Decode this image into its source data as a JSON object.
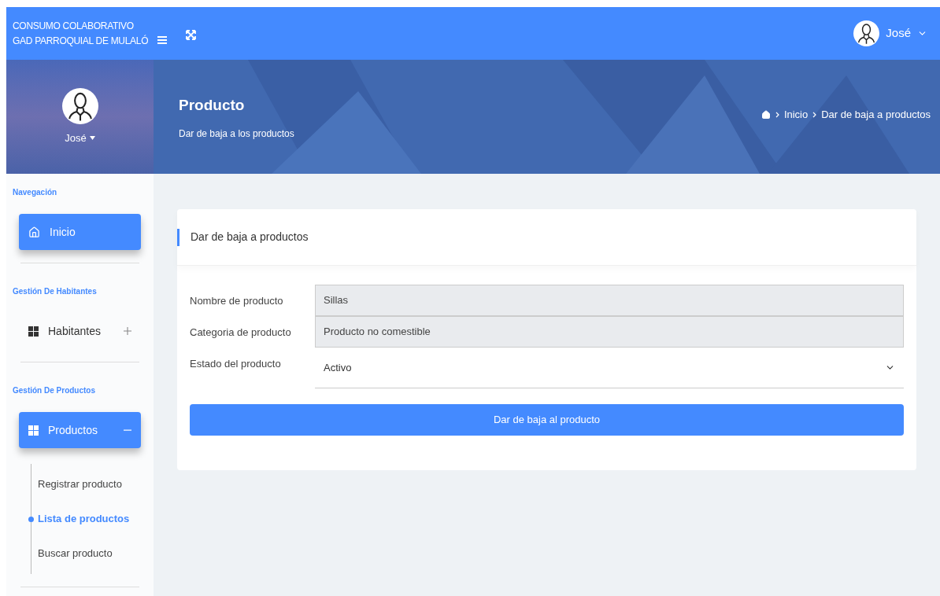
{
  "topbar": {
    "brand_lines": [
      "CONSUMO COLABORATIVO",
      "GAD PARROQUIAL DE MULALÓ"
    ],
    "user_name": "José"
  },
  "profile": {
    "name": "José"
  },
  "page_header": {
    "title": "Producto",
    "subtitle": "Dar de baja a los productos",
    "breadcrumb": [
      "Inicio",
      "Dar de baja a productos"
    ]
  },
  "sidebar": {
    "sections": [
      {
        "heading": "Navegación",
        "items": [
          {
            "label": "Inicio",
            "kind": "link",
            "selected": true
          }
        ]
      },
      {
        "heading": "Gestión De Habitantes",
        "items": [
          {
            "label": "Habitantes",
            "kind": "group",
            "selected": false,
            "expanded": false
          }
        ]
      },
      {
        "heading": "Gestión De Productos",
        "items": [
          {
            "label": "Productos",
            "kind": "group",
            "selected": true,
            "expanded": true,
            "children": [
              {
                "label": "Registrar producto",
                "selected": false
              },
              {
                "label": "Lista de productos",
                "selected": true
              },
              {
                "label": "Buscar producto",
                "selected": false
              }
            ]
          }
        ]
      }
    ]
  },
  "card": {
    "title": "Dar de baja a productos",
    "fields": [
      {
        "label": "Nombre de producto",
        "value": "Sillas",
        "kind": "readonly"
      },
      {
        "label": "Categoria de producto",
        "value": "Producto no comestible",
        "kind": "readonly"
      },
      {
        "label": "Estado del producto",
        "value": "Activo",
        "kind": "select"
      }
    ],
    "button": "Dar de baja al producto"
  }
}
